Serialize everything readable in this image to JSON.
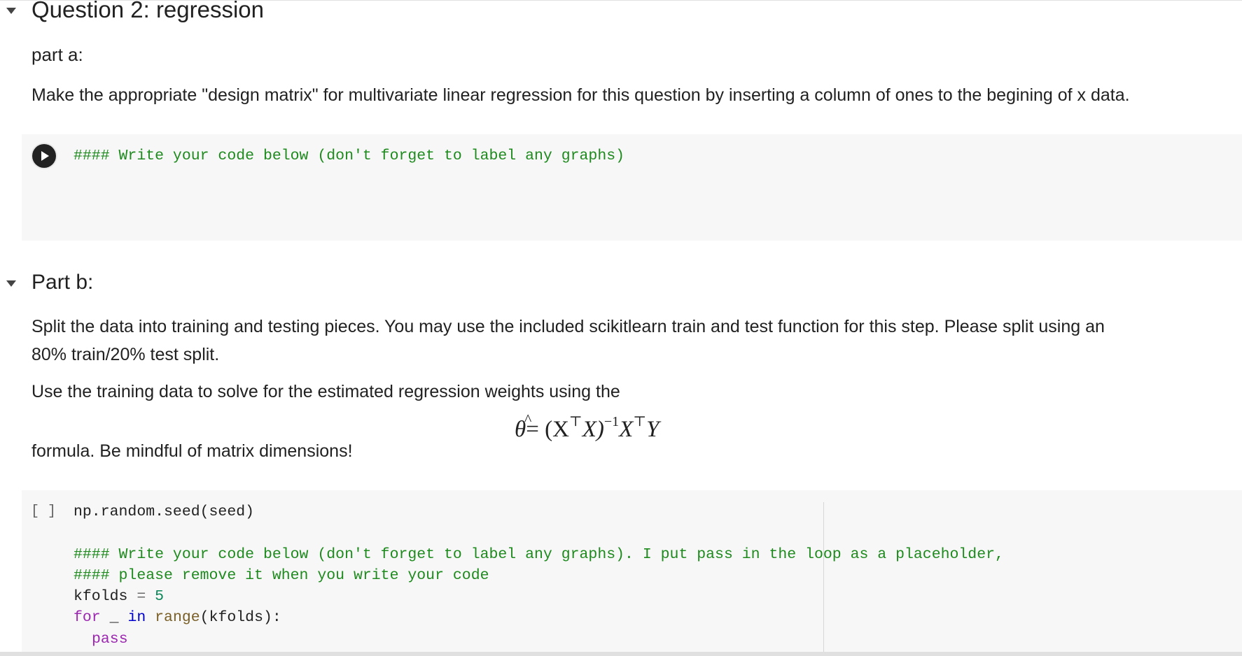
{
  "question_heading": "Question 2: regression",
  "part_a": {
    "title": "part a:",
    "text": "Make the appropriate \"design matrix\" for multivariate linear regression for this question by inserting a column of ones to the begining of x data.",
    "code_line": "#### Write your code below (don't forget to label any graphs)"
  },
  "part_b": {
    "title": "Part b:",
    "text_1": "Split the data into training and testing pieces. You may use the included scikitlearn train and test function for this step. Please split using an",
    "text_2": "80% train/20% test split.",
    "text_3": "Use the training data to solve for the estimated regression weights using the",
    "formula": {
      "theta": "θ",
      "hat": "^",
      "rest": "= (X",
      "t1": "⊤",
      "x": "X)",
      "inv": "−1",
      "x2": "X",
      "t2": "⊤",
      "y": "Y"
    },
    "text_4": "formula. Be mindful of matrix dimensions!",
    "exec_count": "[ ]",
    "code": {
      "l1": "np.random.seed(seed)",
      "l2": "#### Write your code below (don't forget to label any graphs). I put pass in the loop as a placeholder,",
      "l3": "#### please remove it when you write your code",
      "l4_var": "kfolds",
      "l4_op": " = ",
      "l4_num": "5",
      "l5_for": "for",
      "l5_mid": " _ ",
      "l5_in": "in",
      "l5_fn": "range",
      "l5_rest": "(kfolds):",
      "l6": "pass"
    }
  },
  "icons": {
    "collapse_caret": "chevron-down-icon",
    "run_button": "play-icon"
  }
}
